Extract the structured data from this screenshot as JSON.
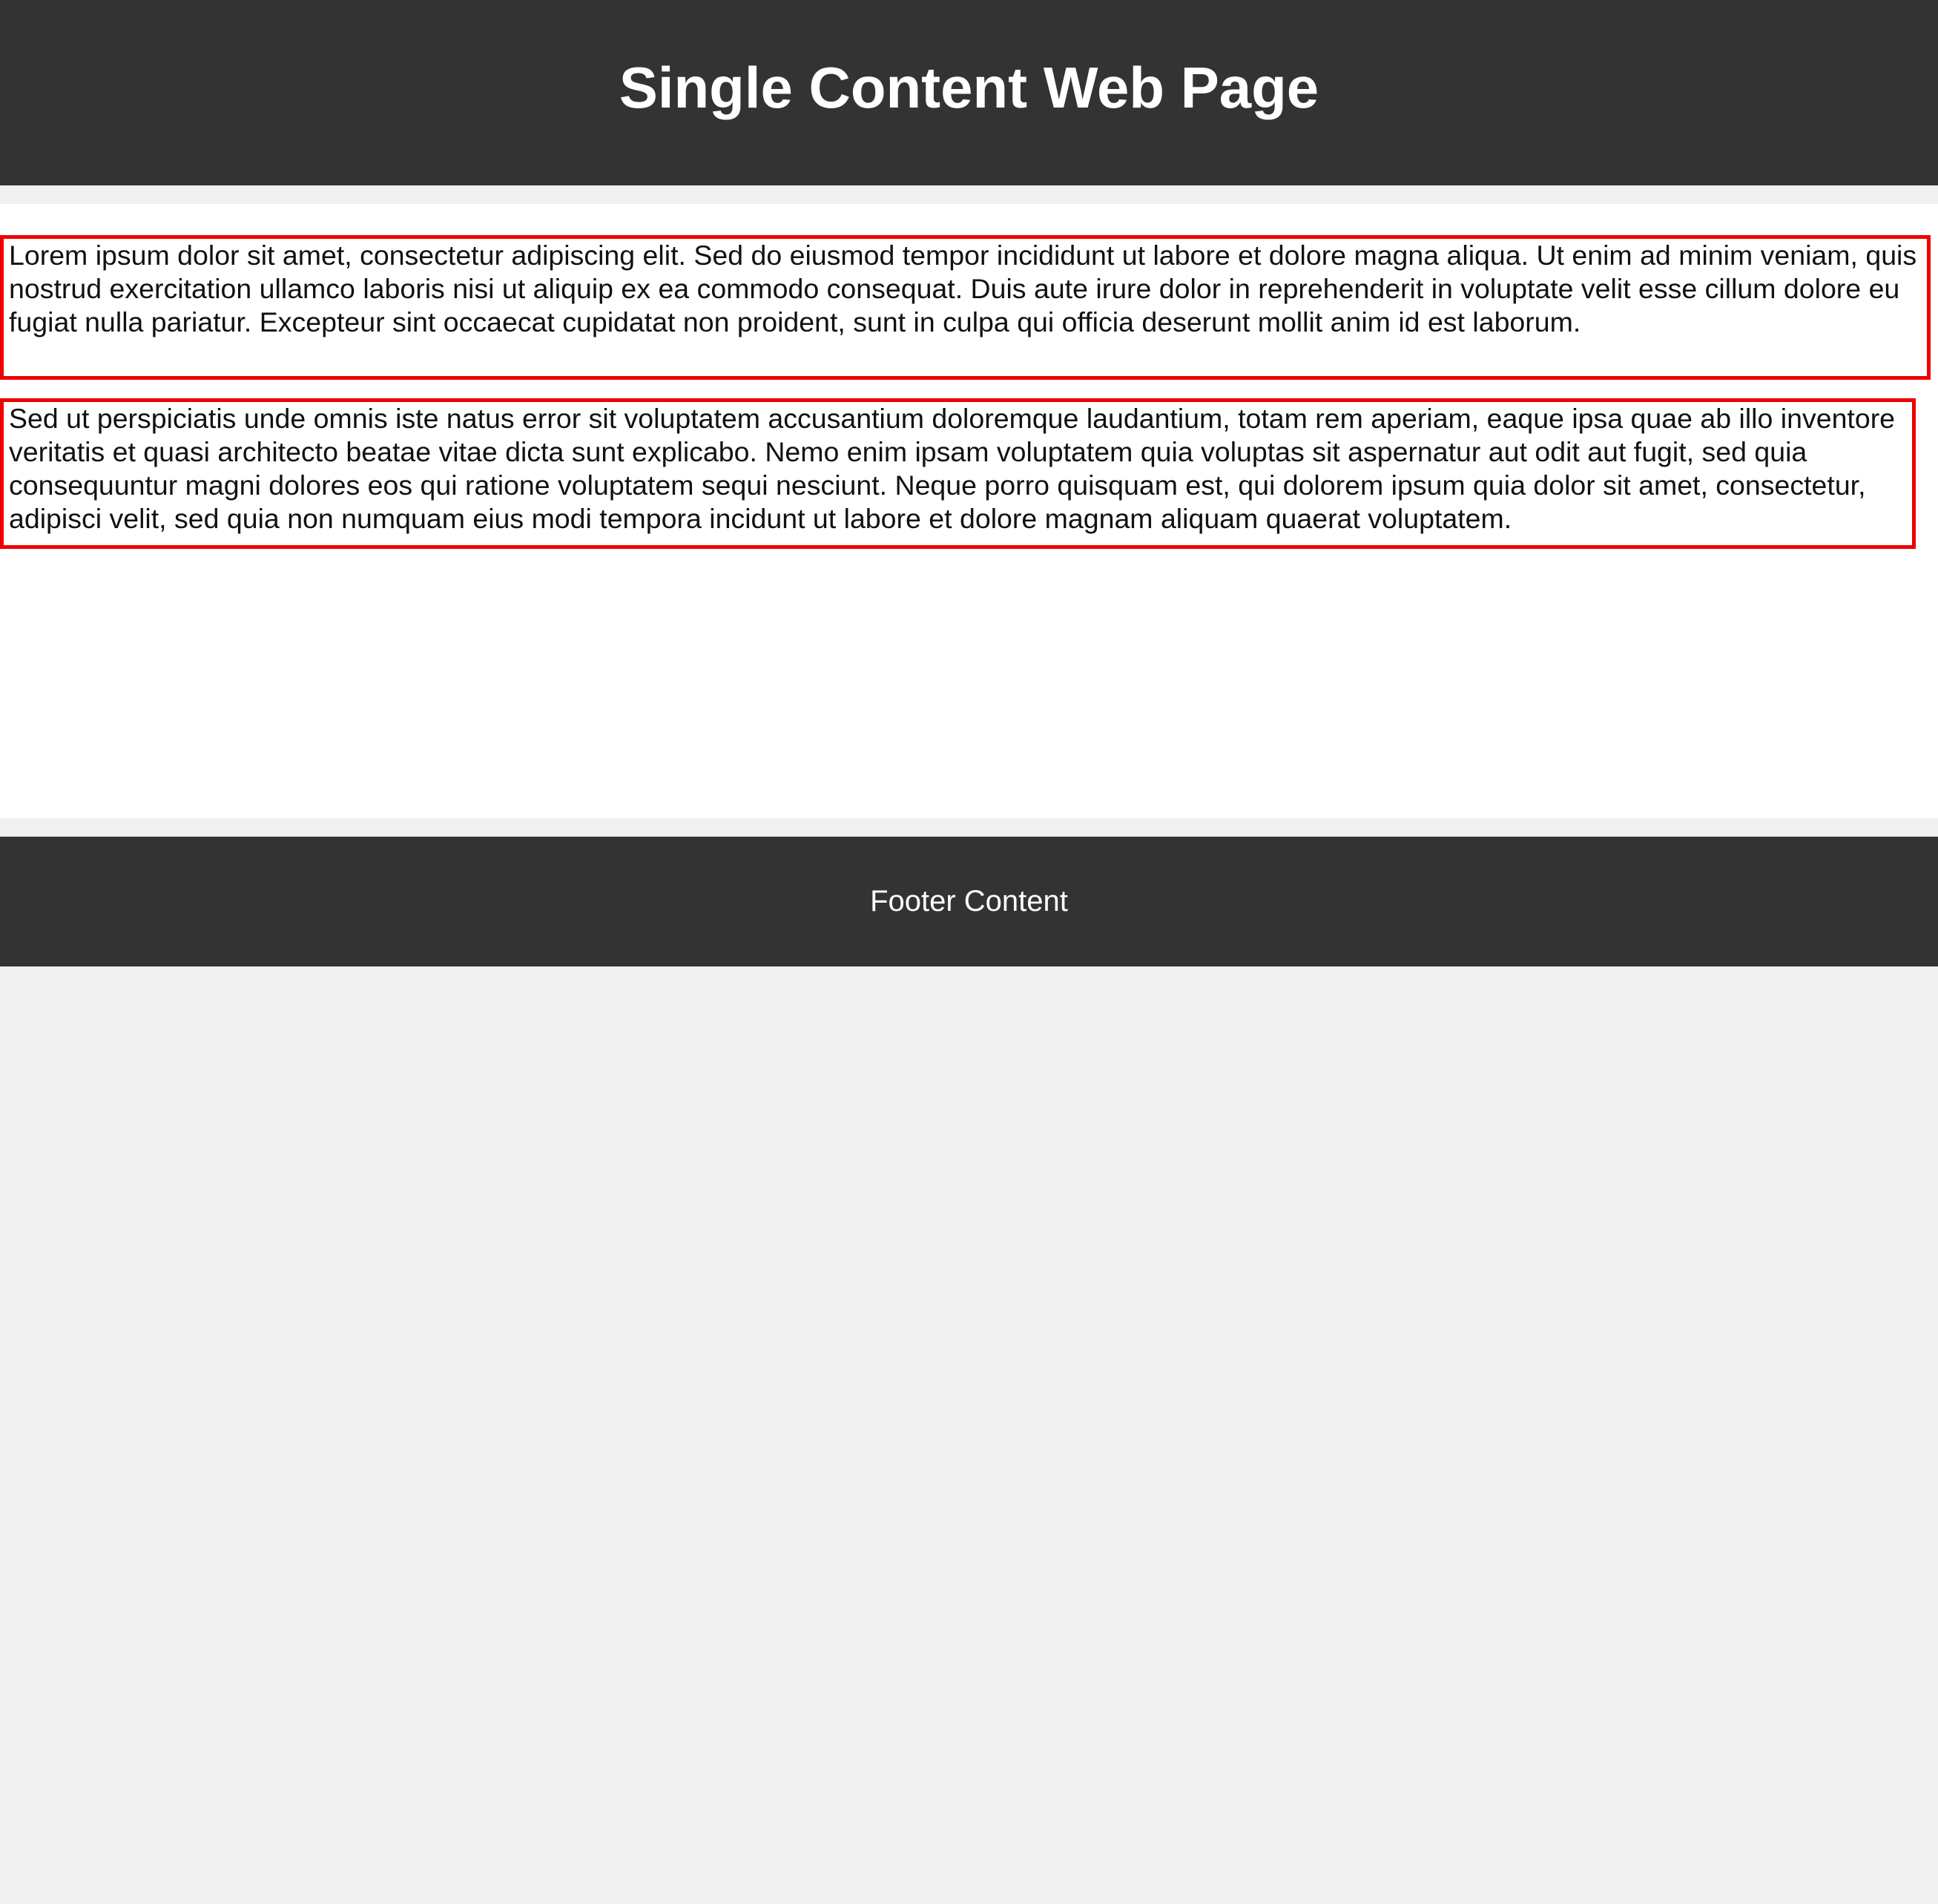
{
  "header": {
    "title": "Single Content Web Page"
  },
  "content": {
    "paragraphs": [
      "Lorem ipsum dolor sit amet, consectetur adipiscing elit. Sed do eiusmod tempor incididunt ut labore et dolore magna aliqua. Ut enim ad minim veniam, quis nostrud exercitation ullamco laboris nisi ut aliquip ex ea commodo consequat. Duis aute irure dolor in reprehenderit in voluptate velit esse cillum dolore eu fugiat nulla pariatur. Excepteur sint occaecat cupidatat non proident, sunt in culpa qui officia deserunt mollit anim id est laborum.",
      "Sed ut perspiciatis unde omnis iste natus error sit voluptatem accusantium doloremque laudantium, totam rem aperiam, eaque ipsa quae ab illo inventore veritatis et quasi architecto beatae vitae dicta sunt explicabo. Nemo enim ipsam voluptatem quia voluptas sit aspernatur aut odit aut fugit, sed quia consequuntur magni dolores eos qui ratione voluptatem sequi nesciunt. Neque porro quisquam est, qui dolorem ipsum quia dolor sit amet, consectetur, adipisci velit, sed quia non numquam eius modi tempora incidunt ut labore et dolore magnam aliquam quaerat voluptatem."
    ]
  },
  "footer": {
    "text": "Footer Content"
  },
  "colors": {
    "header_bg": "#333333",
    "page_bg": "#f0f0f0",
    "content_bg": "#ffffff",
    "highlight_border": "#ee0000"
  }
}
